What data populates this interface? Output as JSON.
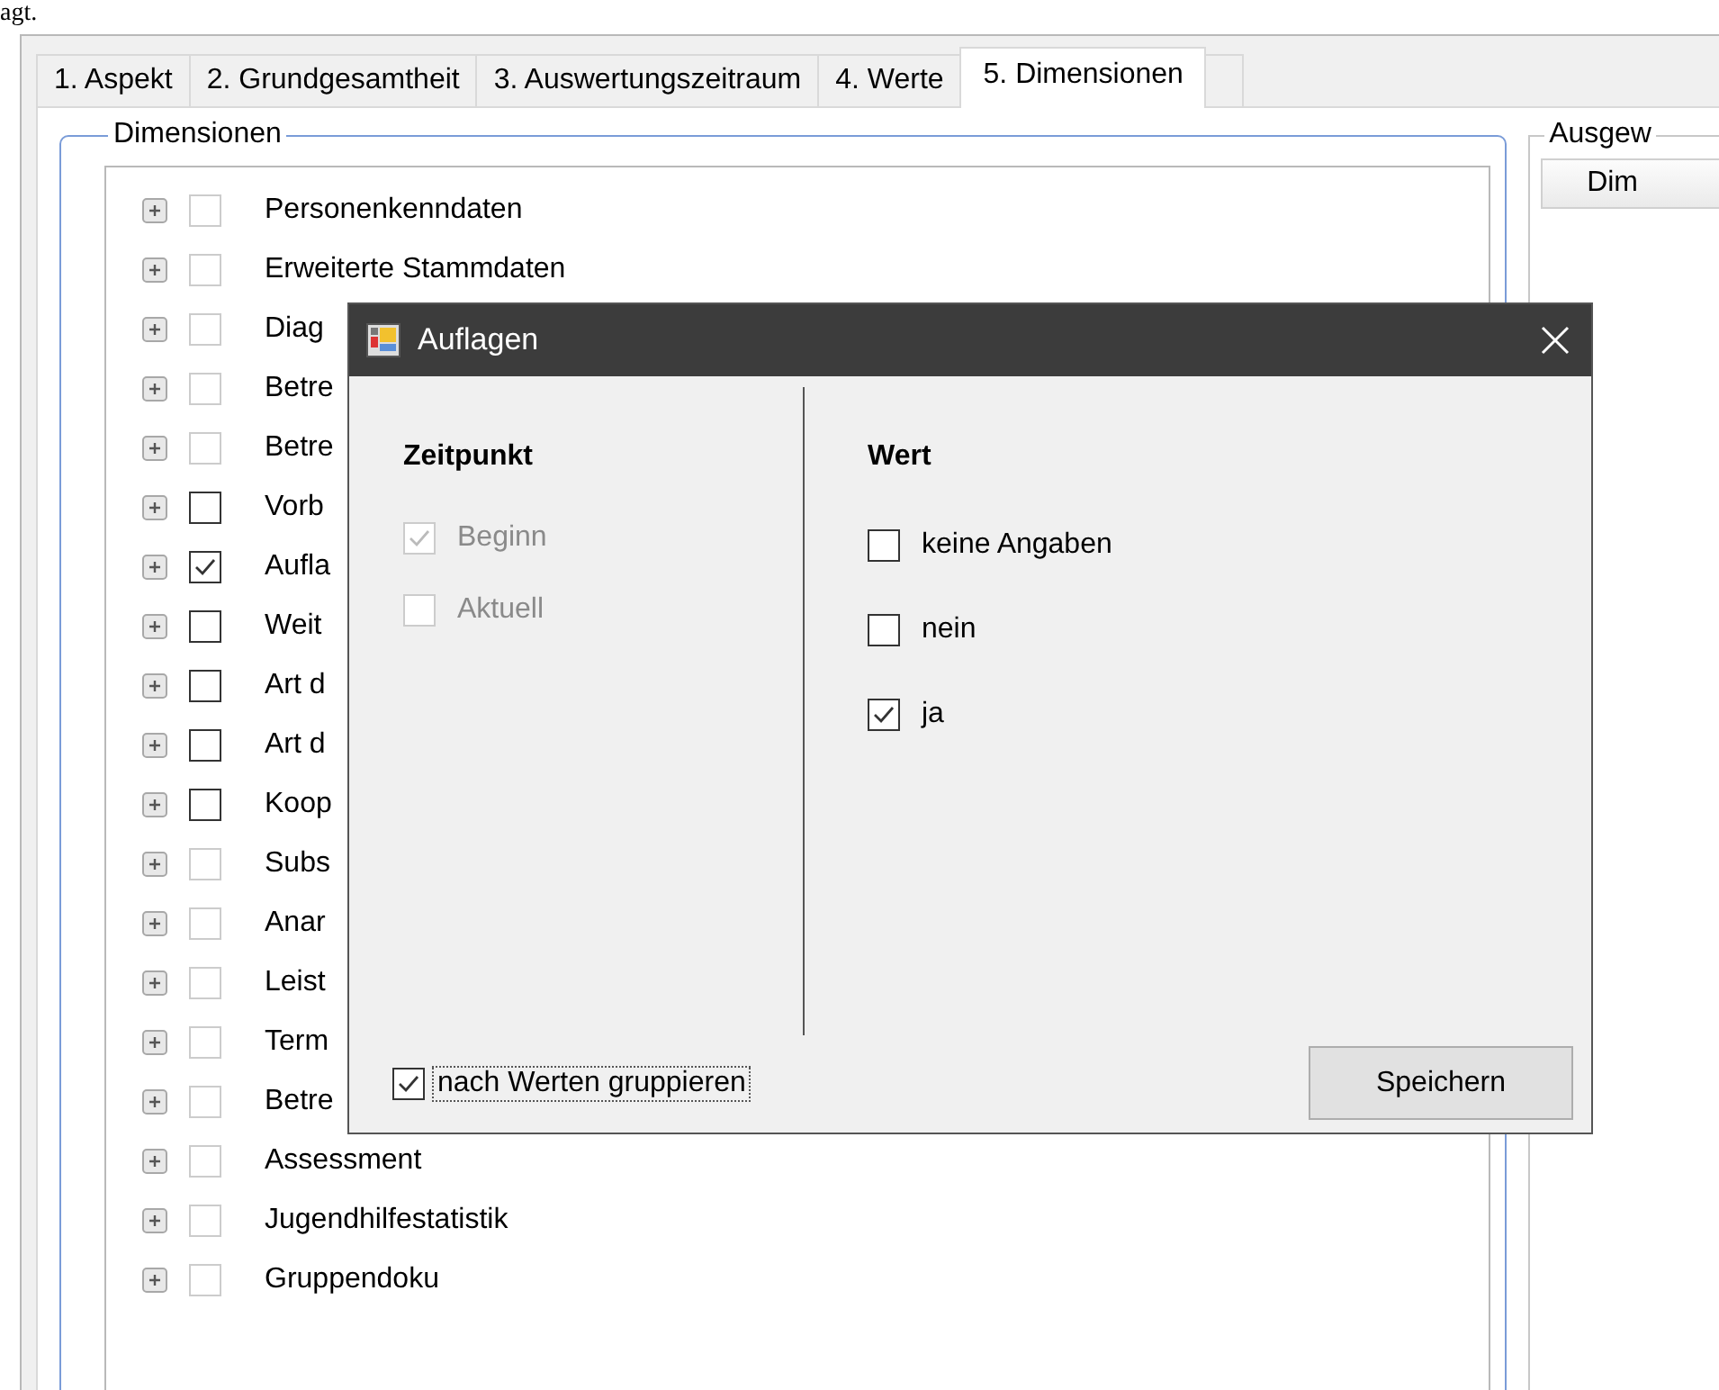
{
  "page_fragment": "agt.",
  "tabs": [
    {
      "label": "1. Aspekt",
      "selected": false
    },
    {
      "label": "2. Grundgesamtheit",
      "selected": false
    },
    {
      "label": "3. Auswertungszeitraum",
      "selected": false
    },
    {
      "label": "4. Werte",
      "selected": false
    },
    {
      "label": "5. Dimensionen",
      "selected": true
    }
  ],
  "dimensions_group": {
    "title": "Dimensionen",
    "items": [
      {
        "label": "Personenkenndaten",
        "checked": false,
        "disabled": true
      },
      {
        "label": "Erweiterte Stammdaten",
        "checked": false,
        "disabled": true
      },
      {
        "label": "Diag",
        "checked": false,
        "disabled": true
      },
      {
        "label": "Betre",
        "checked": false,
        "disabled": true
      },
      {
        "label": "Betre",
        "checked": false,
        "disabled": true
      },
      {
        "label": "Vorb",
        "checked": false,
        "disabled": false
      },
      {
        "label": "Aufla",
        "checked": true,
        "disabled": false
      },
      {
        "label": "Weit",
        "checked": false,
        "disabled": false
      },
      {
        "label": "Art d",
        "checked": false,
        "disabled": false
      },
      {
        "label": "Art d",
        "checked": false,
        "disabled": false
      },
      {
        "label": "Koop",
        "checked": false,
        "disabled": false
      },
      {
        "label": "Subs",
        "checked": false,
        "disabled": true
      },
      {
        "label": "Anar",
        "checked": false,
        "disabled": true
      },
      {
        "label": "Leist",
        "checked": false,
        "disabled": true
      },
      {
        "label": "Term",
        "checked": false,
        "disabled": true
      },
      {
        "label": "Betre",
        "checked": false,
        "disabled": true
      },
      {
        "label": "Assessment",
        "checked": false,
        "disabled": true
      },
      {
        "label": "Jugendhilfestatistik",
        "checked": false,
        "disabled": true
      },
      {
        "label": "Gruppendoku",
        "checked": false,
        "disabled": true
      }
    ]
  },
  "selected_group": {
    "title": "Ausgew",
    "column_header": "Dim"
  },
  "dialog": {
    "title": "Auflagen",
    "zeitpunkt": {
      "heading": "Zeitpunkt",
      "options": [
        {
          "label": "Beginn",
          "checked": true,
          "disabled": true
        },
        {
          "label": "Aktuell",
          "checked": false,
          "disabled": true
        }
      ]
    },
    "wert": {
      "heading": "Wert",
      "options": [
        {
          "label": "keine Angaben",
          "checked": false,
          "disabled": false
        },
        {
          "label": "nein",
          "checked": false,
          "disabled": false
        },
        {
          "label": "ja",
          "checked": true,
          "disabled": false
        }
      ]
    },
    "group_option": {
      "label": "nach Werten gruppieren",
      "checked": true
    },
    "save_button": "Speichern"
  }
}
